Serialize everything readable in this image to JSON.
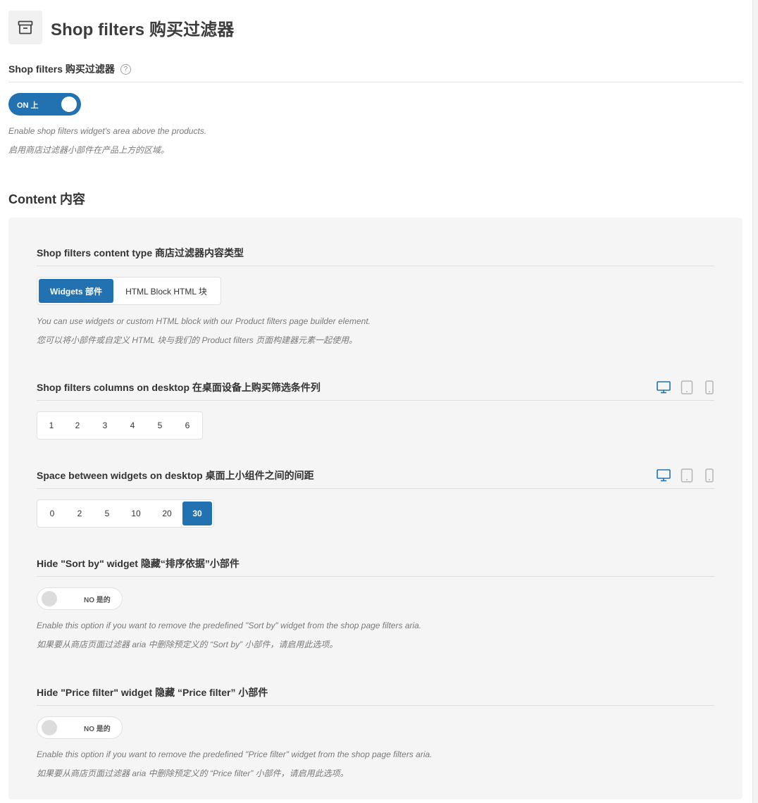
{
  "header": {
    "title": "Shop filters  购买过滤器",
    "icon": "archive-box-icon"
  },
  "shop_filters": {
    "label": "Shop filters  购买过滤器",
    "help": "?",
    "toggle_label": "ON  上",
    "desc_en": "Enable shop filters widget's area above the products.",
    "desc_zh": "启用商店过滤器小部件在产品上方的区域。"
  },
  "content": {
    "title": "Content  内容",
    "content_type": {
      "title": "Shop filters content type  商店过滤器内容类型",
      "options": [
        "Widgets  部件",
        "HTML Block  HTML 块"
      ],
      "selected": "Widgets  部件",
      "desc_en": "You can use widgets or custom HTML block with our Product filters page builder element.",
      "desc_zh": "您可以将小部件或自定义 HTML 块与我们的 Product filters 页面构建器元素一起使用。"
    },
    "columns": {
      "title": "Shop filters columns on desktop  在桌面设备上购买筛选条件列",
      "options": [
        "1",
        "2",
        "3",
        "4",
        "5",
        "6"
      ]
    },
    "spacing": {
      "title": "Space between widgets on desktop  桌面上小组件之间的间距",
      "options": [
        "0",
        "2",
        "5",
        "10",
        "20",
        "30"
      ],
      "selected": "30"
    },
    "hide_sort": {
      "title": "Hide \"Sort by\" widget  隐藏“排序依据”小部件",
      "toggle_label": "NO  是的",
      "desc_en": "Enable this option if you want to remove the predefined \"Sort by\" widget from the shop page filters aria.",
      "desc_zh": "如果要从商店页面过滤器 aria 中删除预定义的 “Sort by” 小部件，请启用此选项。"
    },
    "hide_price": {
      "title": "Hide \"Price filter\" widget  隐藏 “Price filter” 小部件",
      "toggle_label": "NO  是的",
      "desc_en": "Enable this option if you want to remove the predefined \"Price filter\" widget from the shop page filters aria.",
      "desc_zh": "如果要从商店页面过滤器 aria 中删除预定义的 “Price filter” 小部件，请启用此选项。"
    }
  },
  "devices": [
    "desktop-icon",
    "tablet-icon",
    "mobile-icon"
  ],
  "colors": {
    "accent": "#2271b1",
    "panel_bg": "#f5f5f5",
    "inactive_icon": "#b5b5b5"
  }
}
